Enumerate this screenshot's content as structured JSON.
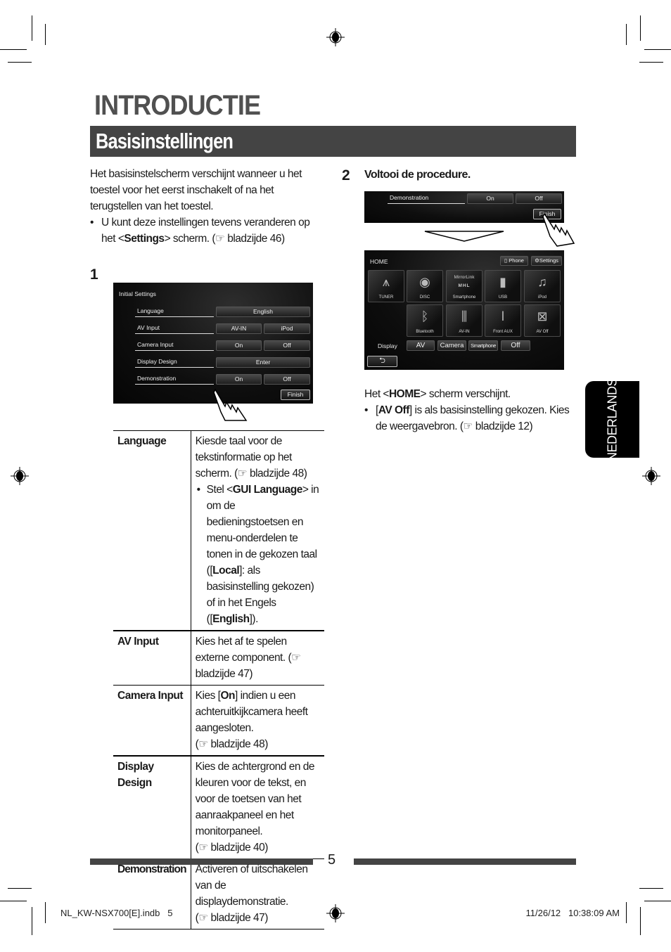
{
  "header": {
    "chapter_title": "INTRODUCTIE",
    "section_title": "Basisinstellingen"
  },
  "intro": {
    "paragraph": "Het basisinstelscherm verschijnt wanneer u het toestel voor het eerst inschakelt of na het terugstellen van het toestel.",
    "bullet_pre": "U kunt deze instellingen tevens veranderen op het <",
    "bullet_bold": "Settings",
    "bullet_post": "> scherm. (☞ bladzijde 46)"
  },
  "step1": {
    "number": "1",
    "screen": {
      "title": "Initial Settings",
      "rows": [
        {
          "label": "Language",
          "buttons": [
            "English"
          ]
        },
        {
          "label": "AV Input",
          "buttons": [
            "AV-IN",
            "iPod"
          ]
        },
        {
          "label": "Camera Input",
          "buttons": [
            "On",
            "Off"
          ]
        },
        {
          "label": "Display Design",
          "buttons": [
            "Enter"
          ]
        },
        {
          "label": "Demonstration",
          "buttons": [
            "On",
            "Off"
          ]
        }
      ],
      "finish_label": "Finish"
    }
  },
  "step2": {
    "number": "2",
    "heading": "Voltooi de procedure.",
    "crop_screen": {
      "row_label": "Demonstration",
      "buttons": [
        "On",
        "Off"
      ],
      "finish_label": "Finish"
    },
    "home_screen": {
      "title": "HOME",
      "phone_label": "Phone",
      "settings_label": "Settings",
      "tiles_row1": [
        {
          "label": "TUNER",
          "icon": "antenna-icon"
        },
        {
          "label": "DISC",
          "icon": "disc-icon"
        },
        {
          "label": "Smartphone",
          "icon": "mirrorlink-mhl-icon",
          "logo1": "MirrorLink",
          "logo2": "MHL"
        },
        {
          "label": "USB",
          "icon": "usb-icon"
        },
        {
          "label": "iPod",
          "icon": "ipod-icon"
        }
      ],
      "tiles_row2": [
        {
          "label": "Bluetooth",
          "icon": "bluetooth-icon"
        },
        {
          "label": "AV-IN",
          "icon": "av-in-icon"
        },
        {
          "label": "Front AUX",
          "icon": "aux-jack-icon"
        },
        {
          "label": "AV Off",
          "icon": "close-box-icon"
        }
      ],
      "display_label": "Display",
      "display_buttons": [
        "AV",
        "Camera",
        "Smartphone",
        "Off"
      ]
    },
    "result_pre": "Het <",
    "result_bold": "HOME",
    "result_post": "> scherm verschijnt.",
    "note_pre": "[",
    "note_bold": "AV Off",
    "note_post": "] is als basisinstelling gekozen. Kies de weergavebron. (☞ bladzijde 12)"
  },
  "table": {
    "rows": [
      {
        "key": "Language",
        "desc": "Kiesde taal voor de tekstinformatie op het scherm. (☞ bladzijde 48)",
        "sub_pre": "Stel <",
        "sub_bold1": "GUI Language",
        "sub_mid1": "> in om de bedieningstoetsen en menu-onderdelen te tonen in de gekozen taal ([",
        "sub_bold2": "Local",
        "sub_mid2": "]: als basisinstelling gekozen) of in het Engels ([",
        "sub_bold3": "English",
        "sub_post": "])."
      },
      {
        "key": "AV Input",
        "desc": "Kies het af te spelen externe component. (☞ bladzijde 47)"
      },
      {
        "key": "Camera Input",
        "desc_pre": "Kies [",
        "desc_bold": "On",
        "desc_post": "] indien u een achteruitkijkcamera heeft aangesloten.",
        "desc_ref": "(☞ bladzijde 48)"
      },
      {
        "key": "Display Design",
        "desc": "Kies de achtergrond en de kleuren voor de tekst, en voor de toetsen van het aanraakpaneel en het monitorpaneel.",
        "desc_ref": "(☞ bladzijde 40)"
      },
      {
        "key": "Demonstration",
        "desc": "Activeren of uitschakelen van de displaydemonstratie.",
        "desc_ref": "(☞ bladzijde 47)"
      }
    ]
  },
  "side_tab": {
    "label": "NEDERLANDS"
  },
  "footer": {
    "page_number": "5",
    "slug_file": "NL_KW-NSX700[E].indb   5",
    "slug_datetime": "11/26/12   10:38:09 AM"
  },
  "colors": {
    "section_band": "#444444",
    "title_gray": "#505050",
    "side_tab": "#000000"
  }
}
